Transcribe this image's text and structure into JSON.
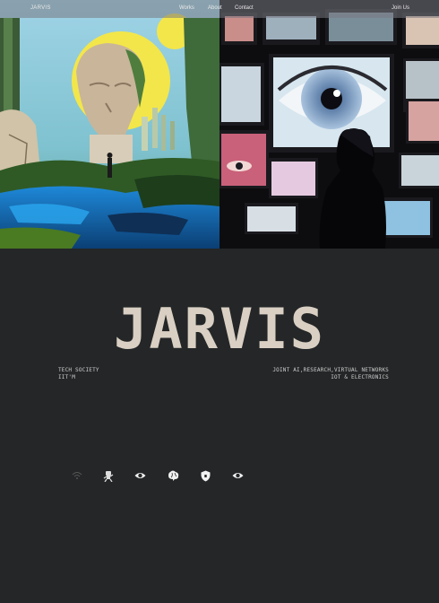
{
  "nav": {
    "brand": "JARVIS",
    "links": [
      "Works",
      "About",
      "Contact"
    ],
    "cta": "Join Us"
  },
  "hero": {
    "left_image": "surreal-statue-landscape-image",
    "right_image": "eyes-on-screens-image"
  },
  "main": {
    "title": "JARVIS",
    "left_info": [
      "TECH SOCIETY",
      "IIT'M"
    ],
    "right_info": [
      "JOINT AI,RESEARCH,VIRTUAL NETWORKS",
      "IOT & ELECTRONICS"
    ]
  },
  "icon_row": [
    "wifi-icon",
    "robot-icon",
    "eye-icon",
    "brain-icon",
    "shield-icon",
    "eye-icon"
  ],
  "colors": {
    "background": "#242627",
    "title": "#d9cfc3",
    "text": "#cfcfcf"
  }
}
